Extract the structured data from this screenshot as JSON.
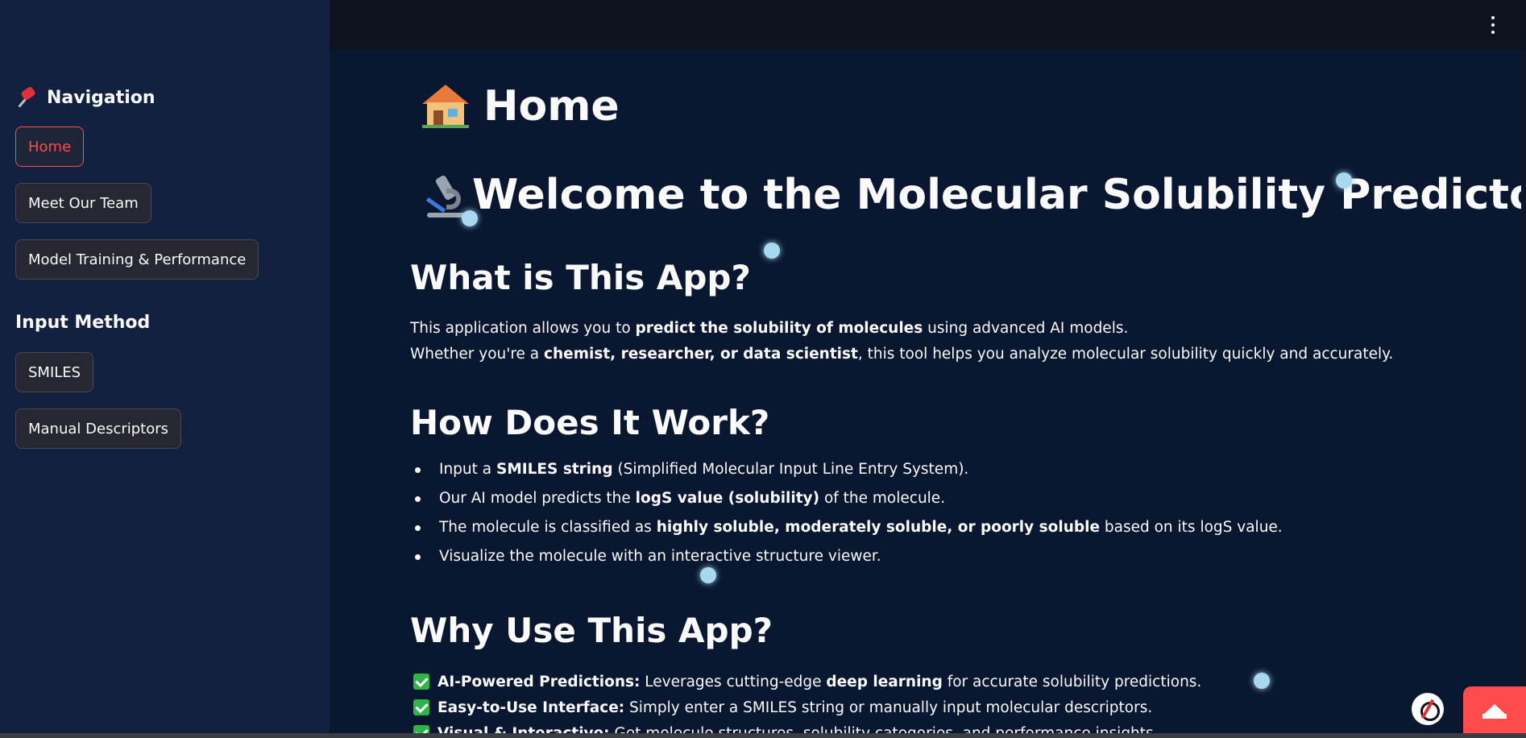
{
  "sidebar": {
    "nav_title": "Navigation",
    "nav_icon": "pushpin-icon",
    "nav_items": [
      {
        "label": "Home",
        "active": true
      },
      {
        "label": "Meet Our Team",
        "active": false
      },
      {
        "label": "Model Training & Performance",
        "active": false
      }
    ],
    "input_method_title": "Input Method",
    "input_items": [
      {
        "label": "SMILES"
      },
      {
        "label": "Manual Descriptors"
      }
    ]
  },
  "page": {
    "home_title": "Home",
    "home_icon": "house-icon",
    "welcome_title": "Welcome to the Molecular Solubility Predictor",
    "welcome_icon": "microscope-icon",
    "what_heading": "What is This App?",
    "what_line1_pre": "This application allows you to ",
    "what_line1_bold": "predict the solubility of molecules",
    "what_line1_post": " using advanced AI models.",
    "what_line2_pre": "Whether you're a ",
    "what_line2_bold": "chemist, researcher, or data scientist",
    "what_line2_post": ", this tool helps you analyze molecular solubility quickly and accurately.",
    "how_heading": "How Does It Work?",
    "how_items": [
      {
        "pre": "Input a ",
        "bold": "SMILES string",
        "post": " (Simplified Molecular Input Line Entry System)."
      },
      {
        "pre": "Our AI model predicts the ",
        "bold": "logS value (solubility)",
        "post": " of the molecule."
      },
      {
        "pre": "The molecule is classified as ",
        "bold": "highly soluble, moderately soluble, or poorly soluble",
        "post": " based on its logS value."
      },
      {
        "pre": "Visualize the molecule with an interactive structure viewer.",
        "bold": "",
        "post": ""
      }
    ],
    "why_heading": "Why Use This App?",
    "why_items": [
      {
        "bold": "AI-Powered Predictions:",
        "pre": " Leverages cutting-edge ",
        "bold2": "deep learning",
        "post": " for accurate solubility predictions."
      },
      {
        "bold": "Easy-to-Use Interface:",
        "pre": " Simply enter a SMILES string or manually input molecular descriptors.",
        "bold2": "",
        "post": ""
      },
      {
        "bold": "Visual & Interactive:",
        "pre": " Get molecule structures, solubility categories, and performance insights.",
        "bold2": "",
        "post": ""
      }
    ]
  },
  "colors": {
    "sidebar_bg": "#11213f",
    "main_bg": "#0a1730",
    "accent": "#ff4b4b",
    "check_green": "#2fb34a"
  }
}
